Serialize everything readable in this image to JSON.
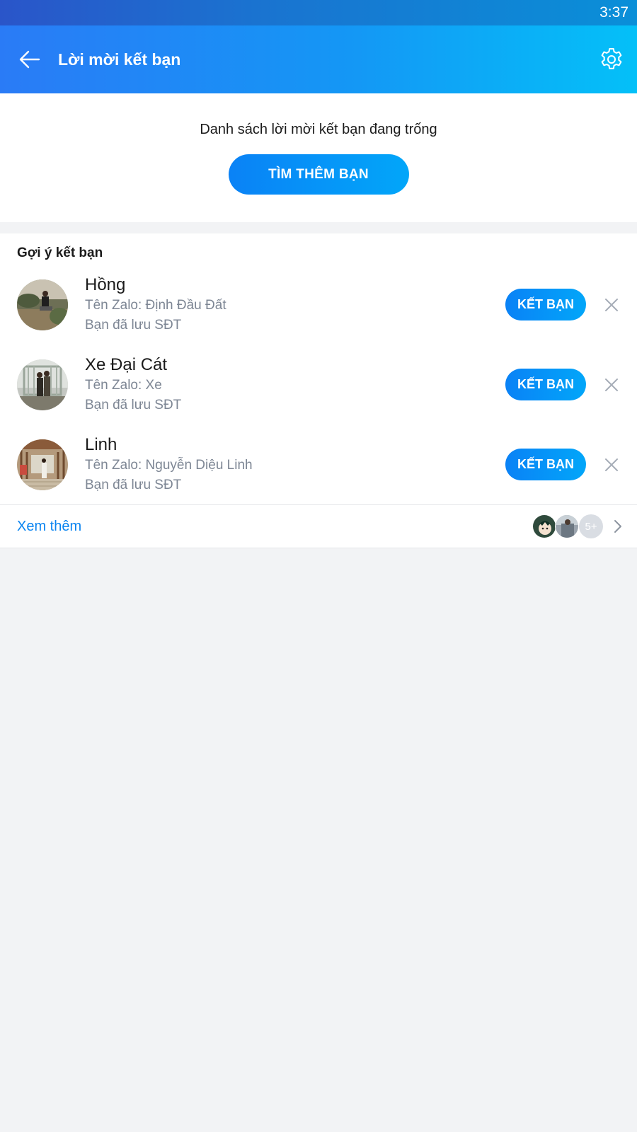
{
  "status": {
    "time": "3:37"
  },
  "header": {
    "title": "Lời mời kết bạn"
  },
  "empty": {
    "message": "Danh sách lời mời kết bạn đang trống",
    "find_button": "TÌM THÊM BẠN"
  },
  "suggestions": {
    "title": "Gợi ý kết bạn",
    "items": [
      {
        "name": "Hồng",
        "zalo_name": "Tên Zalo: Định Đầu Đất",
        "note": "Bạn đã lưu SĐT",
        "action": "KẾT BẠN"
      },
      {
        "name": "Xe Đại Cát",
        "zalo_name": "Tên Zalo: Xe",
        "note": "Bạn đã lưu SĐT",
        "action": "KẾT BẠN"
      },
      {
        "name": "Linh",
        "zalo_name": "Tên Zalo: Nguyễn Diệu Linh",
        "note": "Bạn đã lưu SĐT",
        "action": "KẾT BẠN"
      }
    ],
    "see_more": "Xem thêm",
    "more_count": "5+"
  },
  "colors": {
    "accent": "#0a84f0",
    "header_start": "#2a7bf6",
    "header_end": "#04c0f8",
    "muted_text": "#7d8694",
    "background": "#f2f3f5"
  },
  "icons": [
    "back-arrow-icon",
    "gear-icon",
    "close-icon",
    "chevron-right-icon"
  ]
}
